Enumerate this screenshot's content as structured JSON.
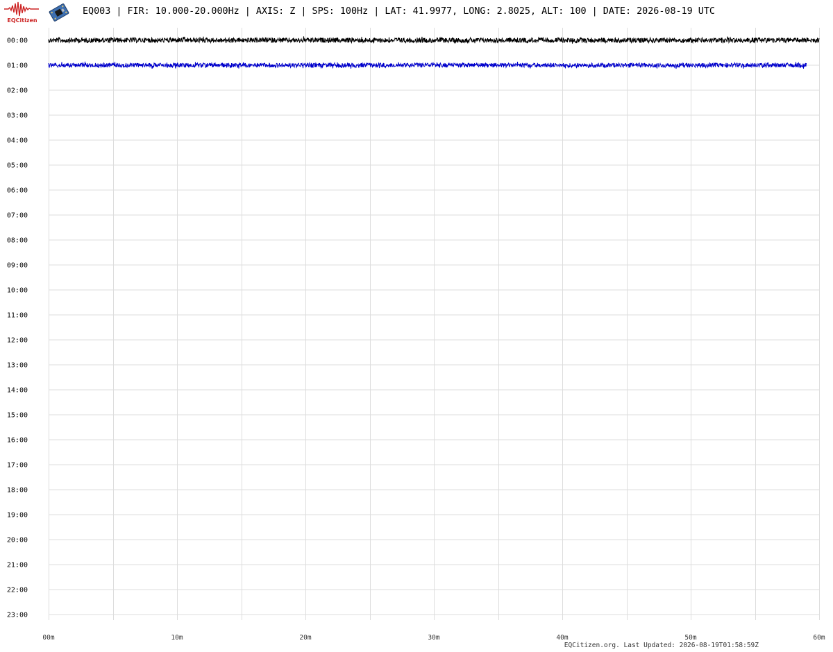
{
  "header": {
    "logo_text": "EQCitizen",
    "logo_icon": "seismogram-logo-icon",
    "sensor_icon": "sensor-board-icon",
    "title": "EQ003 | FIR: 10.000-20.000Hz | AXIS: Z | SPS: 100Hz | LAT: 41.9977, LONG: 2.8025, ALT: 100 | DATE: 2026-08-19 UTC"
  },
  "colors": {
    "accent": "#cc2222",
    "grid": "#dddddd",
    "trace_even_hour": "#000000",
    "trace_odd_hour": "#0000cc"
  },
  "chart_data": {
    "type": "line",
    "title": "",
    "xlabel": "",
    "ylabel": "",
    "xlim": [
      0,
      60
    ],
    "y_categories": [
      "00:00",
      "01:00",
      "02:00",
      "03:00",
      "04:00",
      "05:00",
      "06:00",
      "07:00",
      "08:00",
      "09:00",
      "10:00",
      "11:00",
      "12:00",
      "13:00",
      "14:00",
      "15:00",
      "16:00",
      "17:00",
      "18:00",
      "19:00",
      "20:00",
      "21:00",
      "22:00",
      "23:00"
    ],
    "x_ticks": [
      "00m",
      "10m",
      "20m",
      "30m",
      "40m",
      "50m",
      "60m"
    ],
    "x_tick_values": [
      0,
      10,
      20,
      30,
      40,
      50,
      60
    ],
    "grid_x_values": [
      0,
      5,
      10,
      15,
      20,
      25,
      30,
      35,
      40,
      45,
      50,
      55,
      60
    ],
    "grid": true,
    "series": [
      {
        "hour": "00:00",
        "color": "#000000",
        "x_start_min": 0,
        "x_end_min": 60,
        "noise_amplitude": 0.2
      },
      {
        "hour": "01:00",
        "color": "#0000cc",
        "x_start_min": 0,
        "x_end_min": 59,
        "noise_amplitude": 0.18
      }
    ]
  },
  "footer": {
    "text": "EQCitizen.org. Last Updated: 2026-08-19T01:58:59Z"
  }
}
